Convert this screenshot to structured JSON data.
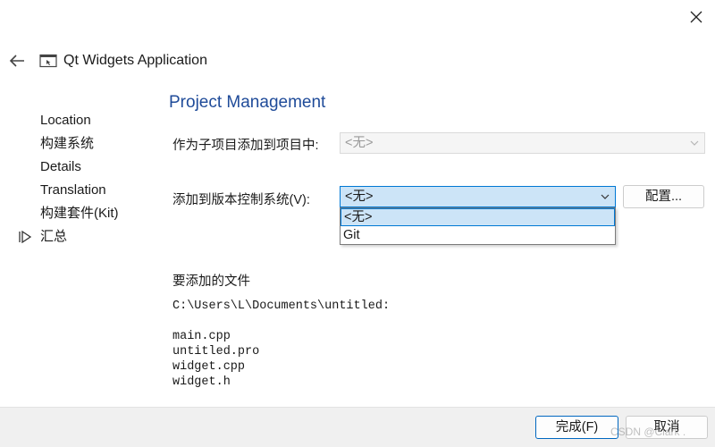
{
  "window": {
    "close_icon": "close-icon"
  },
  "header": {
    "back_icon": "back-arrow-icon",
    "app_icon": "window-icon",
    "title": "Qt Widgets Application"
  },
  "steps": [
    {
      "label": "Location"
    },
    {
      "label": "构建系统"
    },
    {
      "label": "Details"
    },
    {
      "label": "Translation"
    },
    {
      "label": "构建套件(Kit)"
    },
    {
      "label": "汇总",
      "current": true
    }
  ],
  "page": {
    "title": "Project Management",
    "subproject_label": "作为子项目添加到项目中:",
    "subproject_value": "<无>",
    "vcs_label": "添加到版本控制系统(V):",
    "vcs_value": "<无>",
    "configure_button": "配置...",
    "vcs_options": [
      "<无>",
      "Git"
    ],
    "files_heading": "要添加的文件",
    "files_path": "C:\\Users\\L\\Documents\\untitled:",
    "files": [
      "main.cpp",
      "untitled.pro",
      "widget.cpp",
      "widget.h"
    ]
  },
  "footer": {
    "finish_button": "完成(F)",
    "cancel_button": "取消"
  },
  "watermark": "CSDN @Clark ."
}
